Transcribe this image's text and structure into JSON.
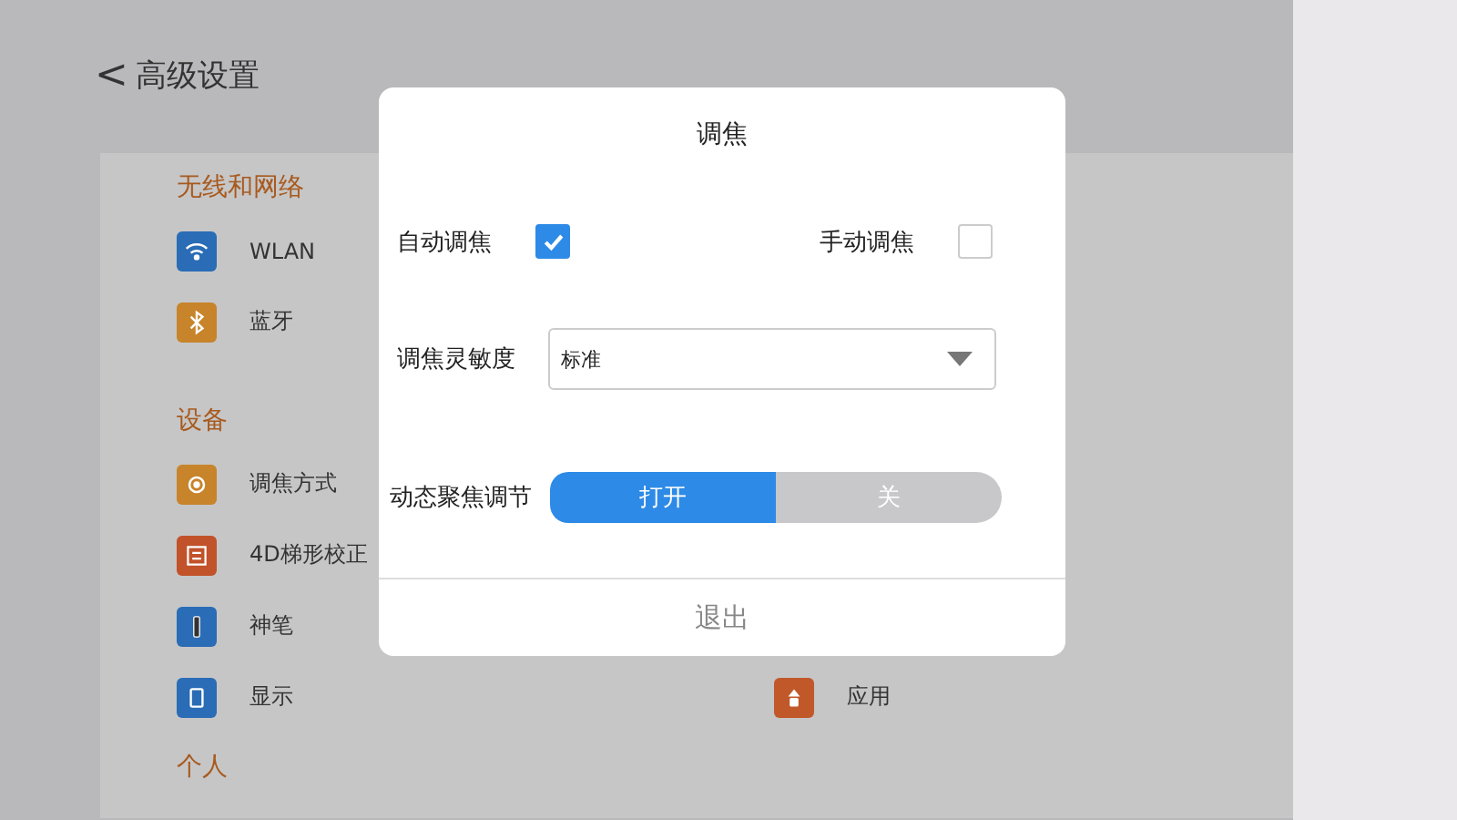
{
  "header": {
    "back": "<",
    "title": "高级设置"
  },
  "sections": [
    {
      "title": "无线和网络",
      "rows": [
        [
          {
            "label": "WLAN",
            "color": "#2a6cb5"
          }
        ],
        [
          {
            "label": "蓝牙",
            "color": "#c7842a"
          }
        ]
      ]
    },
    {
      "title": "设备",
      "rows": [
        [
          {
            "label": "调焦方式",
            "color": "#c7842a"
          }
        ],
        [
          {
            "label": "4D梯形校正",
            "color": "#c1522a"
          }
        ],
        [
          {
            "label": "神笔",
            "color": "#2a6cb5"
          }
        ],
        [
          {
            "label": "显示",
            "color": "#2a6cb5"
          },
          {
            "label": "应用",
            "color": "#c1582a"
          }
        ]
      ]
    },
    {
      "title": "个人"
    }
  ],
  "dialog": {
    "title": "调焦",
    "checks": [
      {
        "label": "自动调焦",
        "checked": true
      },
      {
        "label": "手动调焦",
        "checked": false
      }
    ],
    "sensitivity": {
      "label": "调焦灵敏度",
      "value": "标准"
    },
    "dynamic": {
      "label": "动态聚焦调节",
      "options": [
        {
          "label": "打开",
          "selected": true
        },
        {
          "label": "关",
          "selected": false
        }
      ]
    },
    "exit": "退出"
  }
}
